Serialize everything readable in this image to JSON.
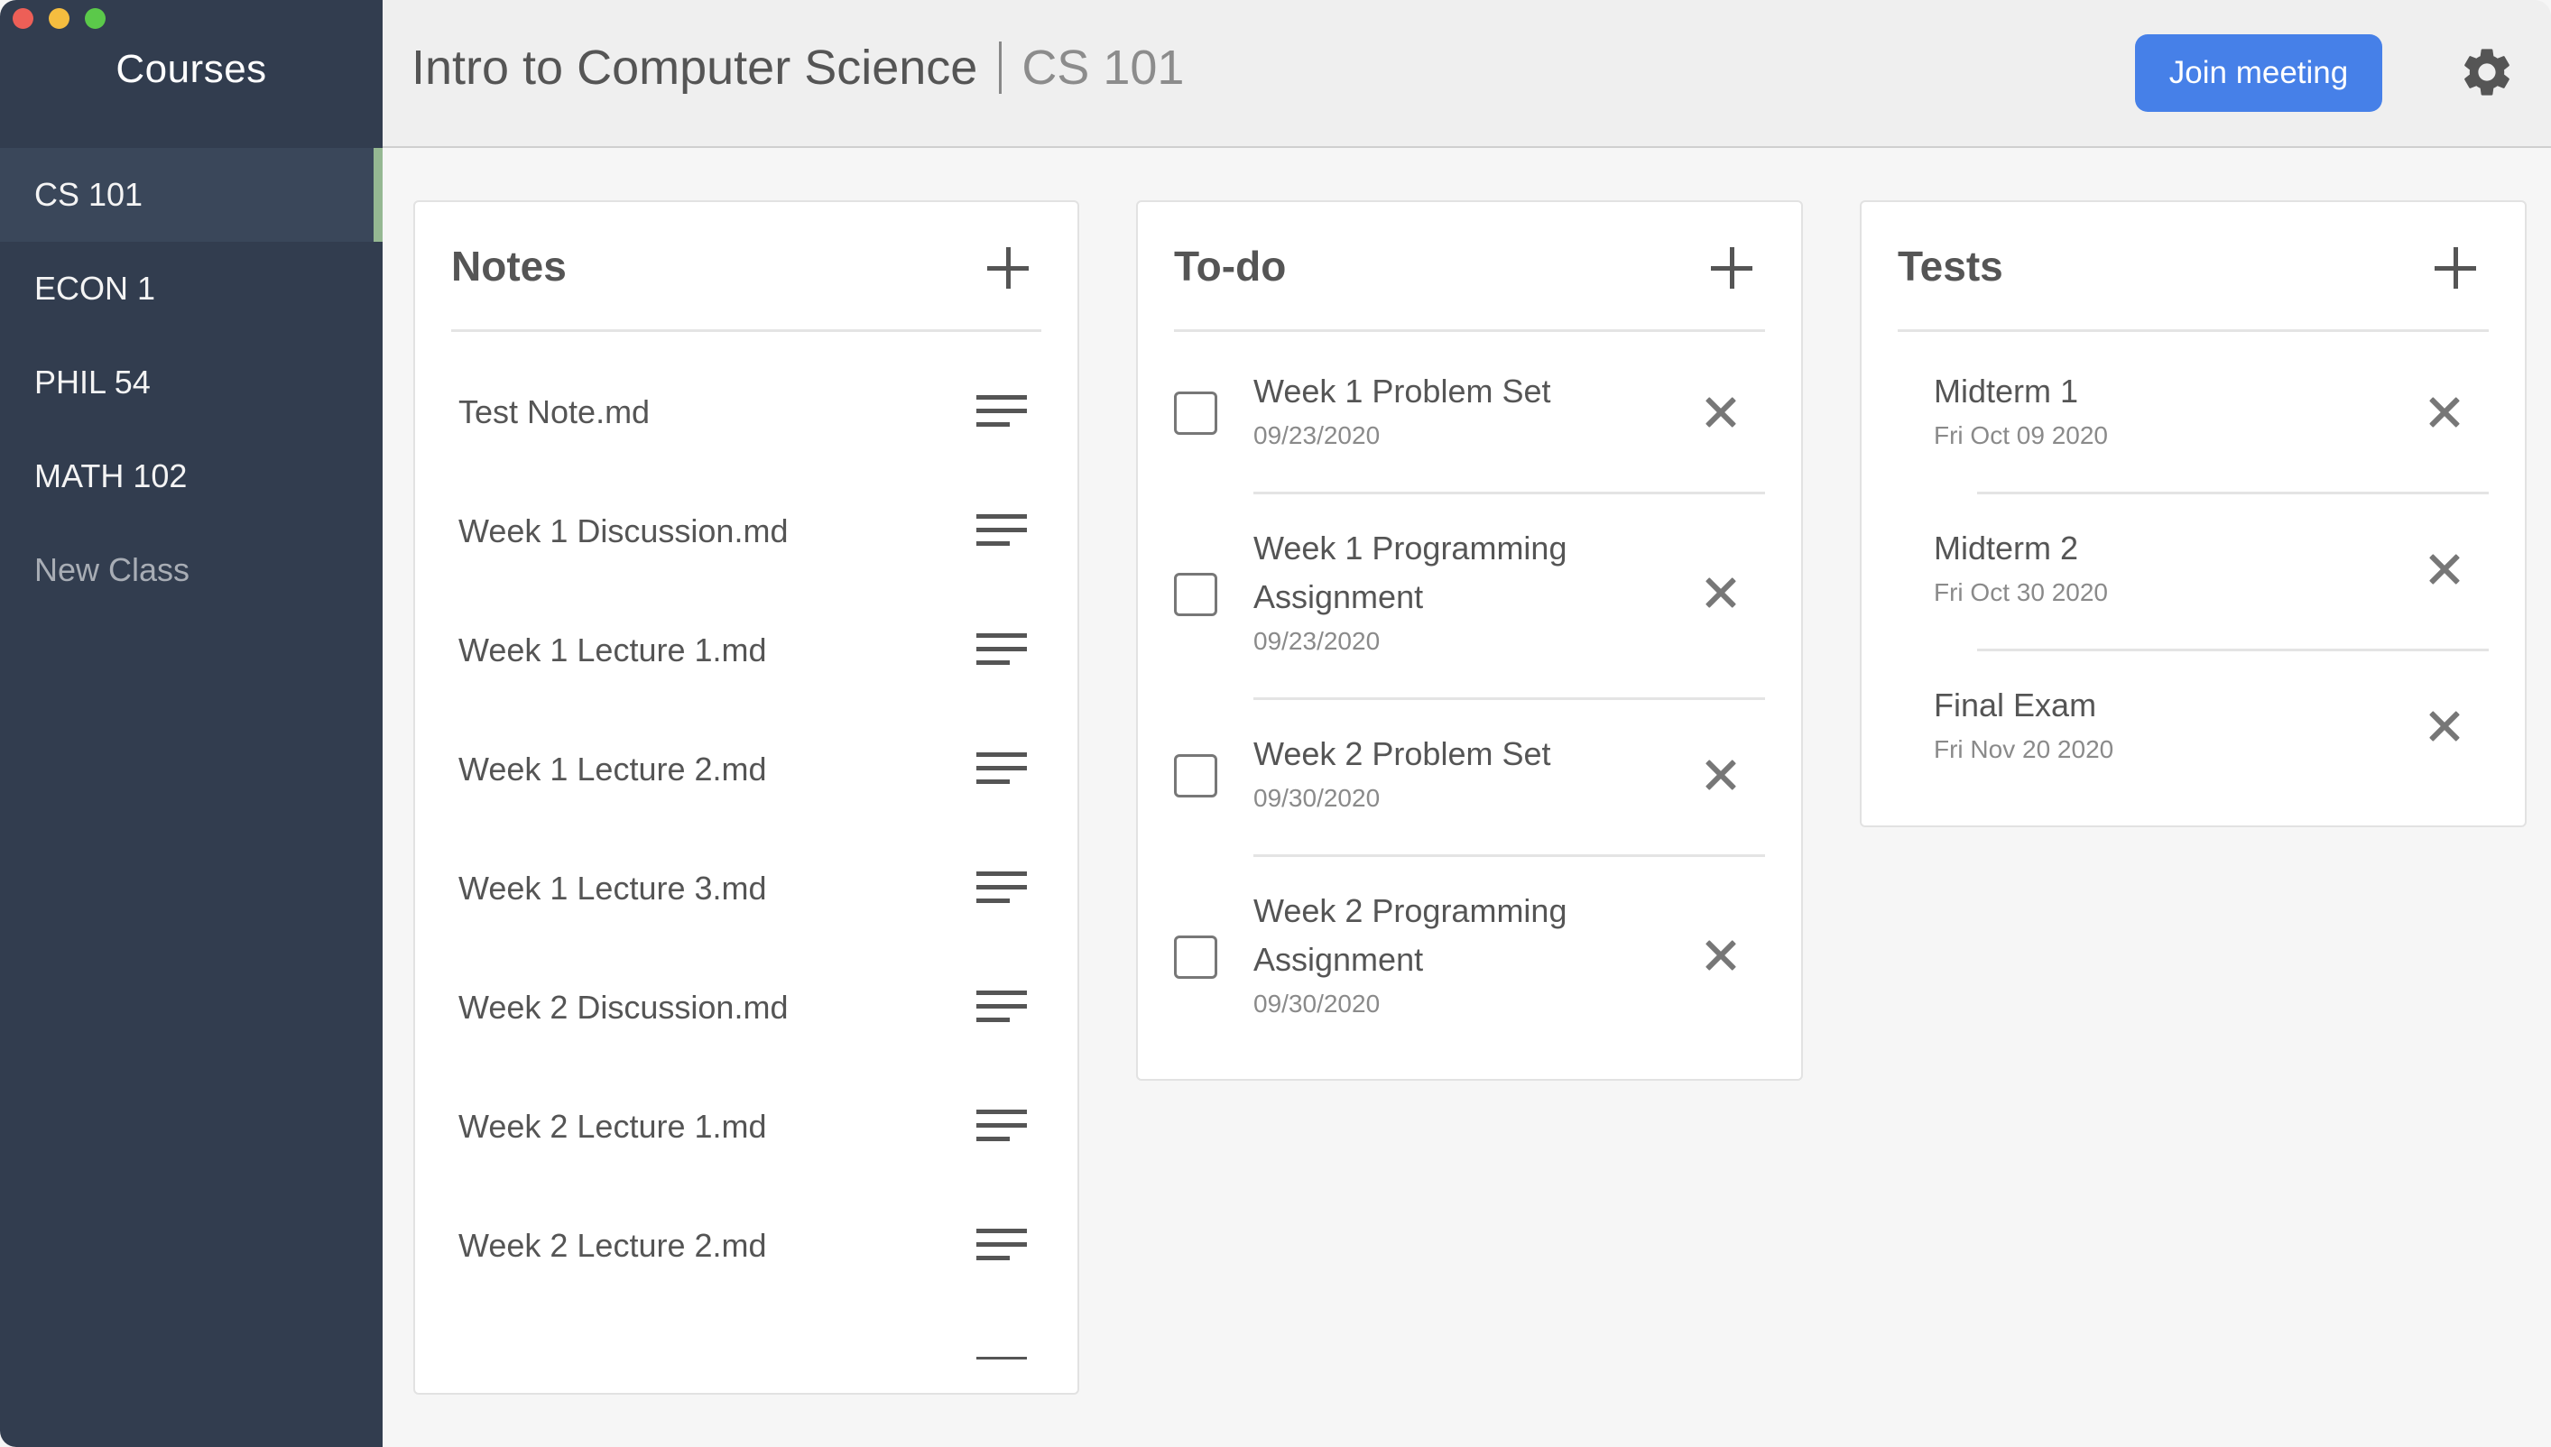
{
  "sidebar": {
    "title": "Courses",
    "items": [
      {
        "label": "CS 101",
        "active": true
      },
      {
        "label": "ECON 1"
      },
      {
        "label": "PHIL 54"
      },
      {
        "label": "MATH 102"
      },
      {
        "label": "New Class"
      }
    ],
    "active_indicator_color": "#95b892"
  },
  "header": {
    "course_name": "Intro to Computer Science",
    "course_code": "CS 101",
    "join_button_label": "Join meeting",
    "join_button_color": "#4680e8",
    "settings_icon": "gear-icon"
  },
  "notes": {
    "title": "Notes",
    "add_icon": "plus-icon",
    "items": [
      {
        "name": "Test Note.md",
        "icon": "notes-lines-icon"
      },
      {
        "name": "Week 1 Discussion.md",
        "icon": "notes-lines-icon"
      },
      {
        "name": "Week 1 Lecture 1.md",
        "icon": "notes-lines-icon"
      },
      {
        "name": "Week 1 Lecture 2.md",
        "icon": "notes-lines-icon"
      },
      {
        "name": "Week 1 Lecture 3.md",
        "icon": "notes-lines-icon"
      },
      {
        "name": "Week 2 Discussion.md",
        "icon": "notes-lines-icon"
      },
      {
        "name": "Week 2 Lecture 1.md",
        "icon": "notes-lines-icon"
      },
      {
        "name": "Week 2 Lecture 2.md",
        "icon": "notes-lines-icon"
      }
    ]
  },
  "todo": {
    "title": "To-do",
    "add_icon": "plus-icon",
    "items": [
      {
        "title": "Week 1 Problem Set",
        "date": "09/23/2020",
        "checked": false
      },
      {
        "title": "Week 1 Programming Assignment",
        "date": "09/23/2020",
        "checked": false
      },
      {
        "title": "Week 2 Problem Set",
        "date": "09/30/2020",
        "checked": false
      },
      {
        "title": "Week 2 Programming Assignment",
        "date": "09/30/2020",
        "checked": false
      }
    ]
  },
  "tests": {
    "title": "Tests",
    "add_icon": "plus-icon",
    "items": [
      {
        "name": "Midterm 1",
        "date": "Fri Oct 09 2020"
      },
      {
        "name": "Midterm 2",
        "date": "Fri Oct 30 2020"
      },
      {
        "name": "Final Exam",
        "date": "Fri Nov 20 2020"
      }
    ]
  }
}
